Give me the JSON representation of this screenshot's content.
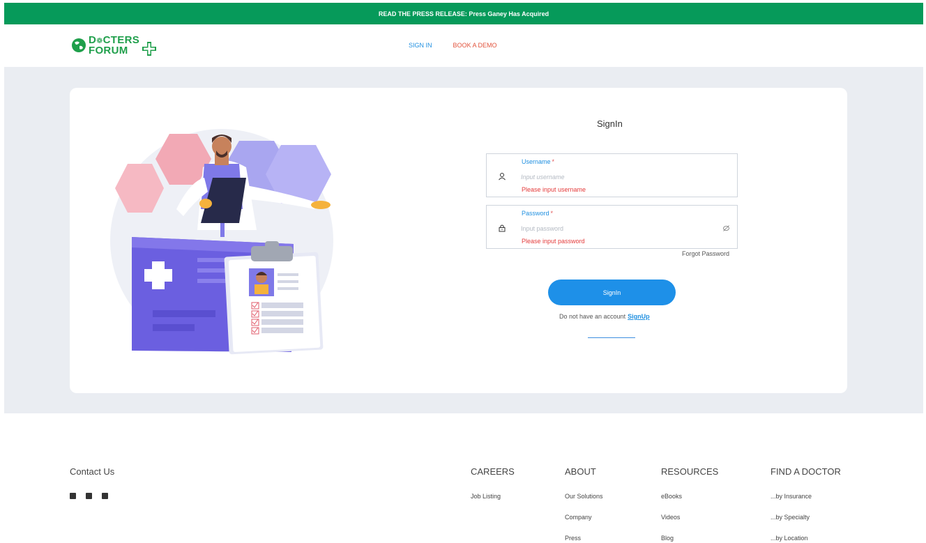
{
  "banner": {
    "text": "READ THE PRESS RELEASE: Press Ganey Has Acquired"
  },
  "header": {
    "logo_line1": "D",
    "logo_line1_rest": "CTERS",
    "logo_line2": "FORUM",
    "nav": {
      "signin": "SIGN IN",
      "demo": "BOOK A DEMO"
    }
  },
  "form": {
    "title": "SignIn",
    "username": {
      "label": "Username",
      "required": "*",
      "placeholder": "Input username",
      "value": "",
      "error": "Please input username"
    },
    "password": {
      "label": "Password",
      "required": "*",
      "placeholder": "Input password",
      "value": "",
      "error": "Please input password"
    },
    "forgot": "Forgot Password",
    "submit": "SignIn",
    "no_account": "Do not have an account",
    "signup": "SignUp"
  },
  "footer": {
    "contact": "Contact Us",
    "social_icons": [
      "facebook-icon",
      "linkedin-icon",
      "youtube-icon"
    ],
    "columns": {
      "careers": {
        "title": "CAREERS",
        "links": [
          "Job Listing"
        ]
      },
      "about": {
        "title": "ABOUT",
        "links": [
          "Our Solutions",
          "Company",
          "Press"
        ]
      },
      "resources": {
        "title": "RESOURCES",
        "links": [
          "eBooks",
          "Videos",
          "Blog"
        ]
      },
      "find": {
        "title": "FIND A DOCTOR",
        "links": [
          "...by Insurance",
          "...by Specialty",
          "...by Location"
        ]
      }
    }
  },
  "colors": {
    "banner": "#069a5a",
    "brand_green": "#1f9f4b",
    "primary_blue": "#1e90e8",
    "error_red": "#e43b3b",
    "page_bg": "#eaedf2"
  }
}
